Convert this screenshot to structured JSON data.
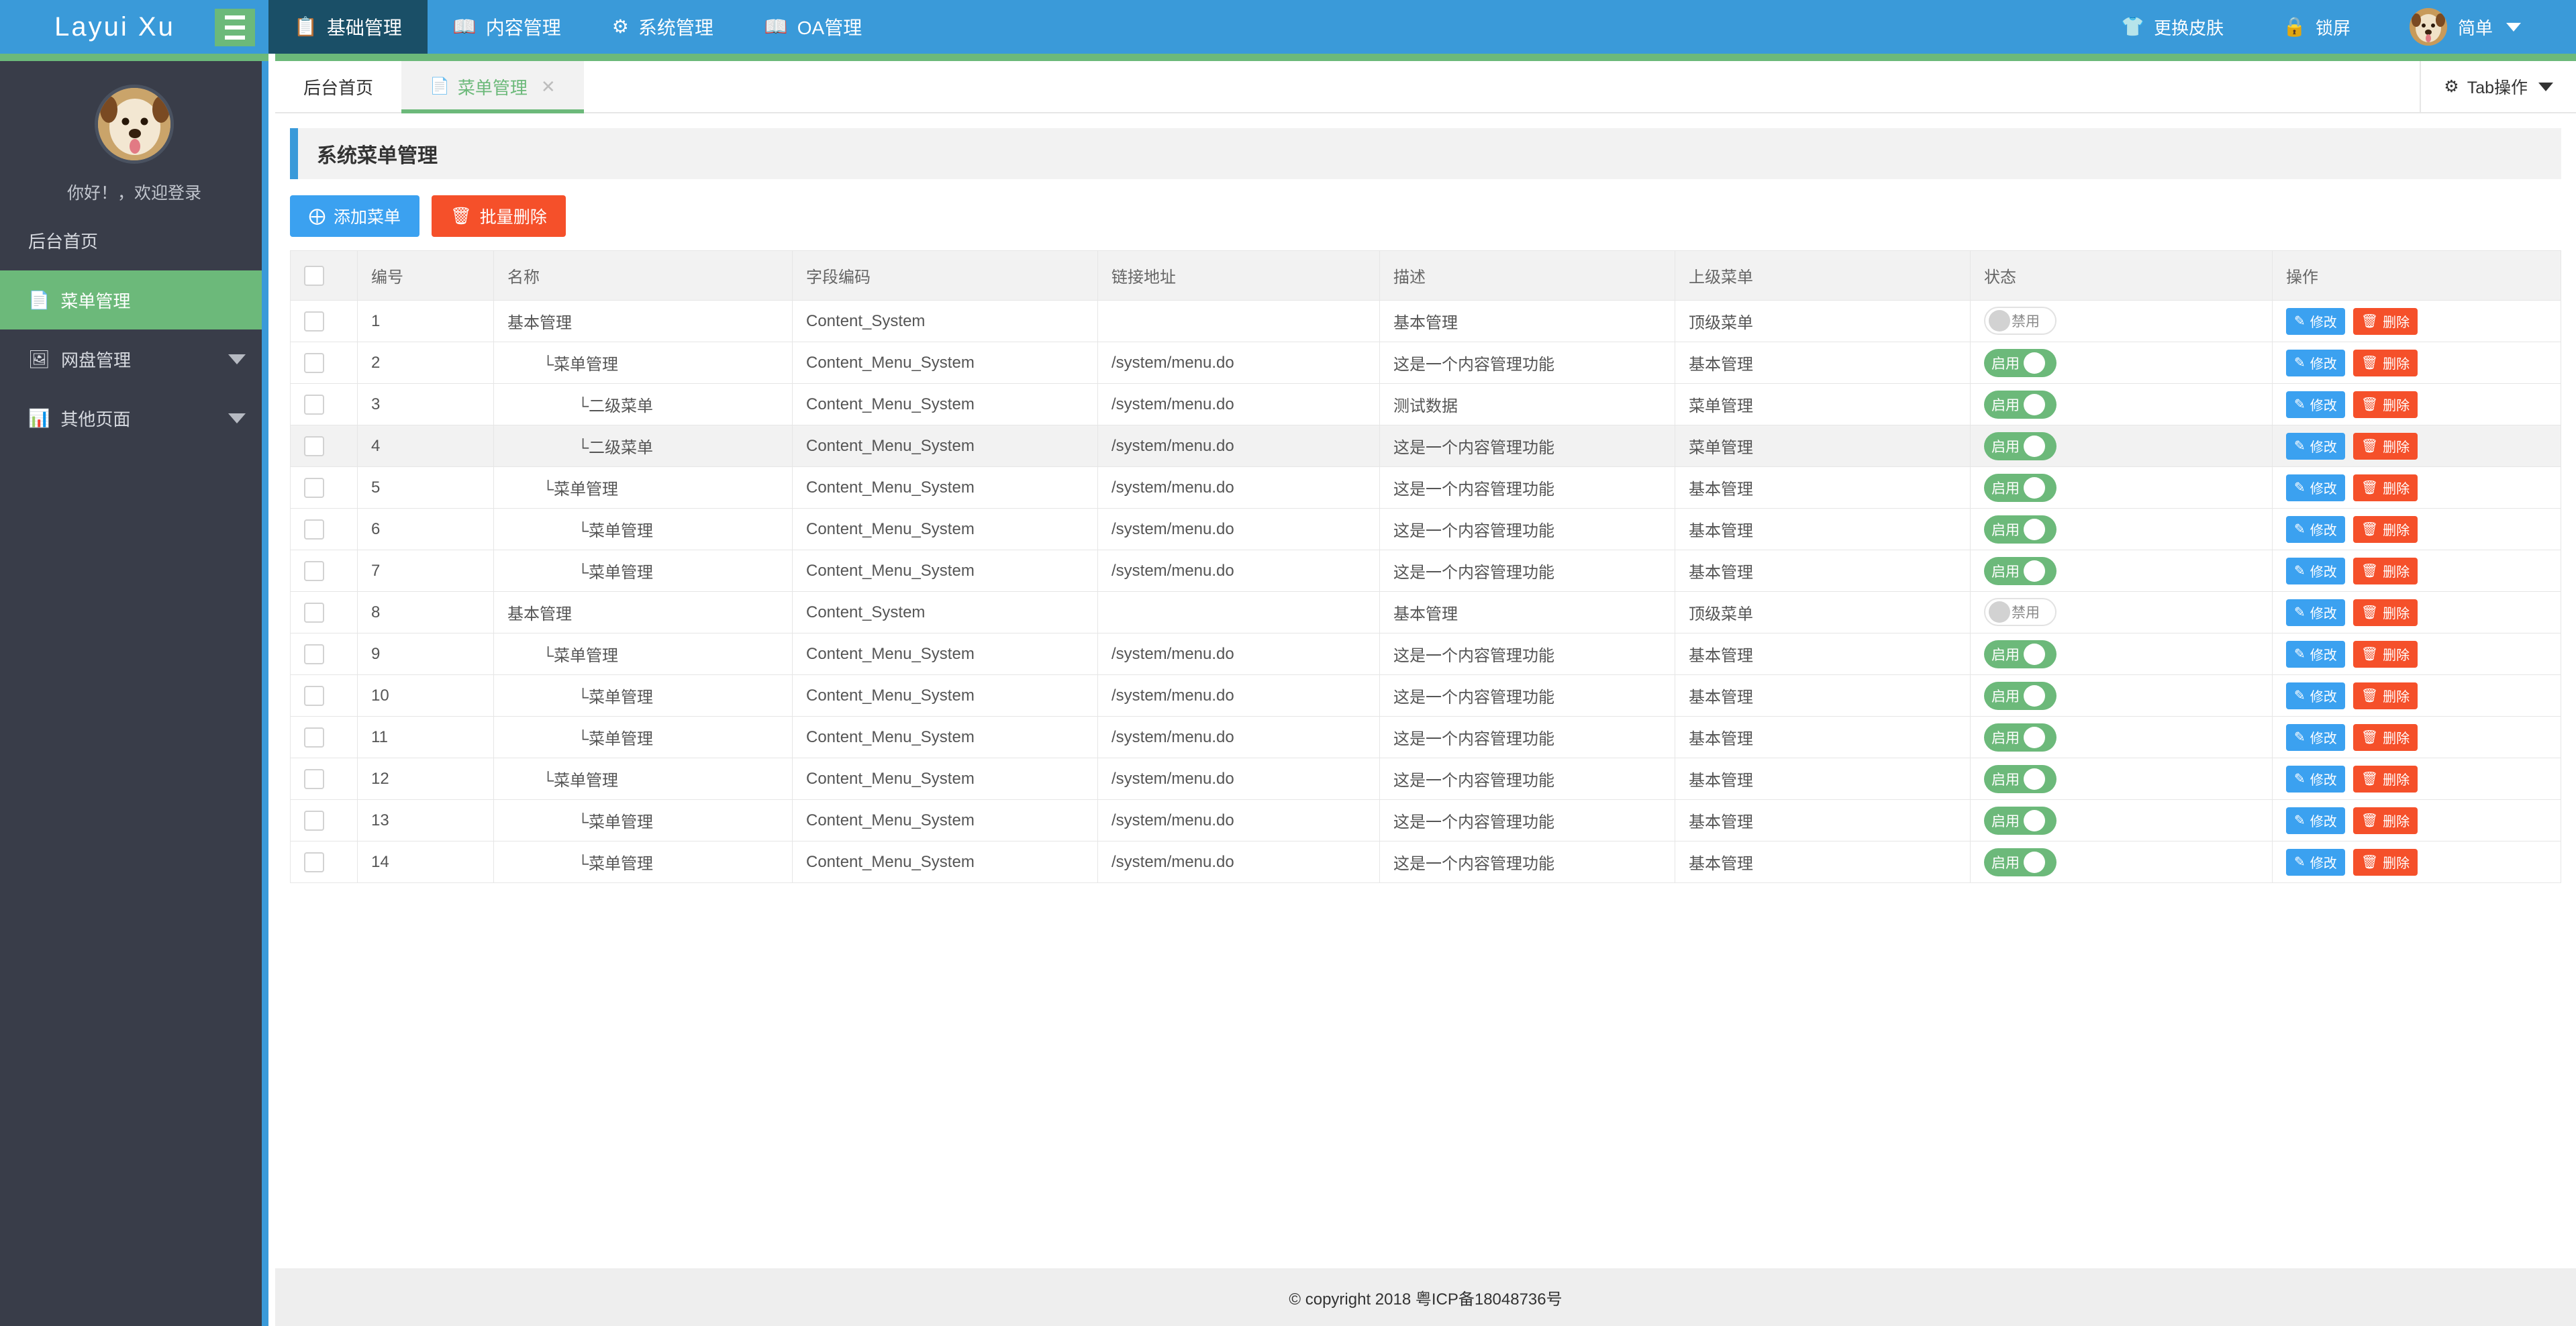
{
  "header": {
    "brand": "Layui Xu",
    "menu_toggle_icon": "hamburger-icon",
    "nav": [
      {
        "label": "基础管理",
        "icon": "clipboard-icon",
        "active": true
      },
      {
        "label": "内容管理",
        "icon": "book-icon",
        "active": false
      },
      {
        "label": "系统管理",
        "icon": "gear-icon",
        "active": false
      },
      {
        "label": "OA管理",
        "icon": "book-icon",
        "active": false
      }
    ],
    "right": {
      "skin_label": "更换皮肤",
      "skin_icon": "shirt-icon",
      "lock_label": "锁屏",
      "lock_icon": "lock-icon",
      "user_label": "简单",
      "avatar_icon": "user-avatar"
    }
  },
  "sidebar": {
    "greeting": "你好！，欢迎登录",
    "home_label": "后台首页",
    "items": [
      {
        "label": "菜单管理",
        "icon": "file-icon",
        "active": true,
        "has_children": false
      },
      {
        "label": "网盘管理",
        "icon": "image-icon",
        "active": false,
        "has_children": true
      },
      {
        "label": "其他页面",
        "icon": "chart-icon",
        "active": false,
        "has_children": true
      }
    ]
  },
  "tabs": {
    "items": [
      {
        "label": "后台首页",
        "icon": "",
        "active": false,
        "closable": false
      },
      {
        "label": "菜单管理",
        "icon": "file-icon",
        "active": true,
        "closable": true
      }
    ],
    "ops_label": "Tab操作",
    "ops_icon": "gear-icon"
  },
  "page": {
    "title": "系统菜单管理",
    "add_label": "添加菜单",
    "add_icon": "plus-circle-icon",
    "delete_label": "批量删除",
    "delete_icon": "trash-icon"
  },
  "table": {
    "columns": [
      "编号",
      "名称",
      "字段编码",
      "链接地址",
      "描述",
      "上级菜单",
      "状态",
      "操作"
    ],
    "edit_label": "修改",
    "edit_icon": "pencil-square-icon",
    "delete_label": "删除",
    "delete_icon": "trash-icon",
    "status_on_label": "启用",
    "status_off_label": "禁用",
    "rows": [
      {
        "id": "1",
        "name": "基本管理",
        "indent": 0,
        "code": "Content_System",
        "url": "",
        "desc": "基本管理",
        "parent": "顶级菜单",
        "status": "off",
        "hl": false
      },
      {
        "id": "2",
        "name": "└菜单管理",
        "indent": 1,
        "code": "Content_Menu_System",
        "url": "/system/menu.do",
        "desc": "这是一个内容管理功能",
        "parent": "基本管理",
        "status": "on",
        "hl": false
      },
      {
        "id": "3",
        "name": "└二级菜单",
        "indent": 2,
        "code": "Content_Menu_System",
        "url": "/system/menu.do",
        "desc": "测试数据",
        "parent": "菜单管理",
        "status": "on",
        "hl": false
      },
      {
        "id": "4",
        "name": "└二级菜单",
        "indent": 2,
        "code": "Content_Menu_System",
        "url": "/system/menu.do",
        "desc": "这是一个内容管理功能",
        "parent": "菜单管理",
        "status": "on",
        "hl": true
      },
      {
        "id": "5",
        "name": "└菜单管理",
        "indent": 1,
        "code": "Content_Menu_System",
        "url": "/system/menu.do",
        "desc": "这是一个内容管理功能",
        "parent": "基本管理",
        "status": "on",
        "hl": false
      },
      {
        "id": "6",
        "name": "└菜单管理",
        "indent": 2,
        "code": "Content_Menu_System",
        "url": "/system/menu.do",
        "desc": "这是一个内容管理功能",
        "parent": "基本管理",
        "status": "on",
        "hl": false
      },
      {
        "id": "7",
        "name": "└菜单管理",
        "indent": 2,
        "code": "Content_Menu_System",
        "url": "/system/menu.do",
        "desc": "这是一个内容管理功能",
        "parent": "基本管理",
        "status": "on",
        "hl": false
      },
      {
        "id": "8",
        "name": "基本管理",
        "indent": 0,
        "code": "Content_System",
        "url": "",
        "desc": "基本管理",
        "parent": "顶级菜单",
        "status": "off",
        "hl": false
      },
      {
        "id": "9",
        "name": "└菜单管理",
        "indent": 1,
        "code": "Content_Menu_System",
        "url": "/system/menu.do",
        "desc": "这是一个内容管理功能",
        "parent": "基本管理",
        "status": "on",
        "hl": false
      },
      {
        "id": "10",
        "name": "└菜单管理",
        "indent": 2,
        "code": "Content_Menu_System",
        "url": "/system/menu.do",
        "desc": "这是一个内容管理功能",
        "parent": "基本管理",
        "status": "on",
        "hl": false
      },
      {
        "id": "11",
        "name": "└菜单管理",
        "indent": 2,
        "code": "Content_Menu_System",
        "url": "/system/menu.do",
        "desc": "这是一个内容管理功能",
        "parent": "基本管理",
        "status": "on",
        "hl": false
      },
      {
        "id": "12",
        "name": "└菜单管理",
        "indent": 1,
        "code": "Content_Menu_System",
        "url": "/system/menu.do",
        "desc": "这是一个内容管理功能",
        "parent": "基本管理",
        "status": "on",
        "hl": false
      },
      {
        "id": "13",
        "name": "└菜单管理",
        "indent": 2,
        "code": "Content_Menu_System",
        "url": "/system/menu.do",
        "desc": "这是一个内容管理功能",
        "parent": "基本管理",
        "status": "on",
        "hl": false
      },
      {
        "id": "14",
        "name": "└菜单管理",
        "indent": 2,
        "code": "Content_Menu_System",
        "url": "/system/menu.do",
        "desc": "这是一个内容管理功能",
        "parent": "基本管理",
        "status": "on",
        "hl": false
      }
    ]
  },
  "footer": {
    "text": "© copyright 2018 粤ICP备18048736号"
  },
  "colors": {
    "header_blue": "#3a9ad9",
    "nav_active": "#1a4f67",
    "green": "#6cb97a",
    "sidebar_dark": "#393d49",
    "btn_blue": "#3ba1f0",
    "btn_red": "#f5502a",
    "title_accent": "#3a9ad9"
  }
}
